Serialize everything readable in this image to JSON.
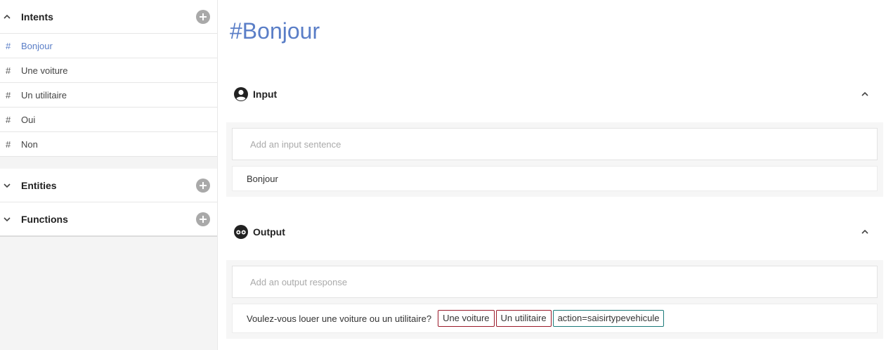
{
  "sidebar": {
    "intents": {
      "title": "Intents",
      "items": [
        {
          "label": "Bonjour",
          "active": true
        },
        {
          "label": "Une voiture"
        },
        {
          "label": "Un utilitaire"
        },
        {
          "label": "Oui"
        },
        {
          "label": "Non"
        }
      ]
    },
    "entities": {
      "title": "Entities"
    },
    "functions": {
      "title": "Functions"
    }
  },
  "main": {
    "title": "#Bonjour",
    "input": {
      "title": "Input",
      "placeholder": "Add an input sentence",
      "sentences": [
        "Bonjour"
      ]
    },
    "output": {
      "title": "Output",
      "placeholder": "Add an output response",
      "response_text": "Voulez-vous louer une voiture ou un utilitaire?",
      "tags": [
        {
          "label": "Une voiture",
          "kind": "intent"
        },
        {
          "label": "Un utilitaire",
          "kind": "intent"
        },
        {
          "label": "action=saisirtypevehicule",
          "kind": "action"
        }
      ]
    }
  },
  "colors": {
    "accent": "#5a7ec7",
    "intent_tag_border": "#9b1b2b",
    "action_tag_border": "#1b7a7a"
  },
  "icons": {
    "input": "user-circle-icon",
    "output": "bot-face-icon",
    "add": "plus-circle-icon",
    "collapse": "chevron-up-icon",
    "expand": "chevron-down-icon"
  }
}
